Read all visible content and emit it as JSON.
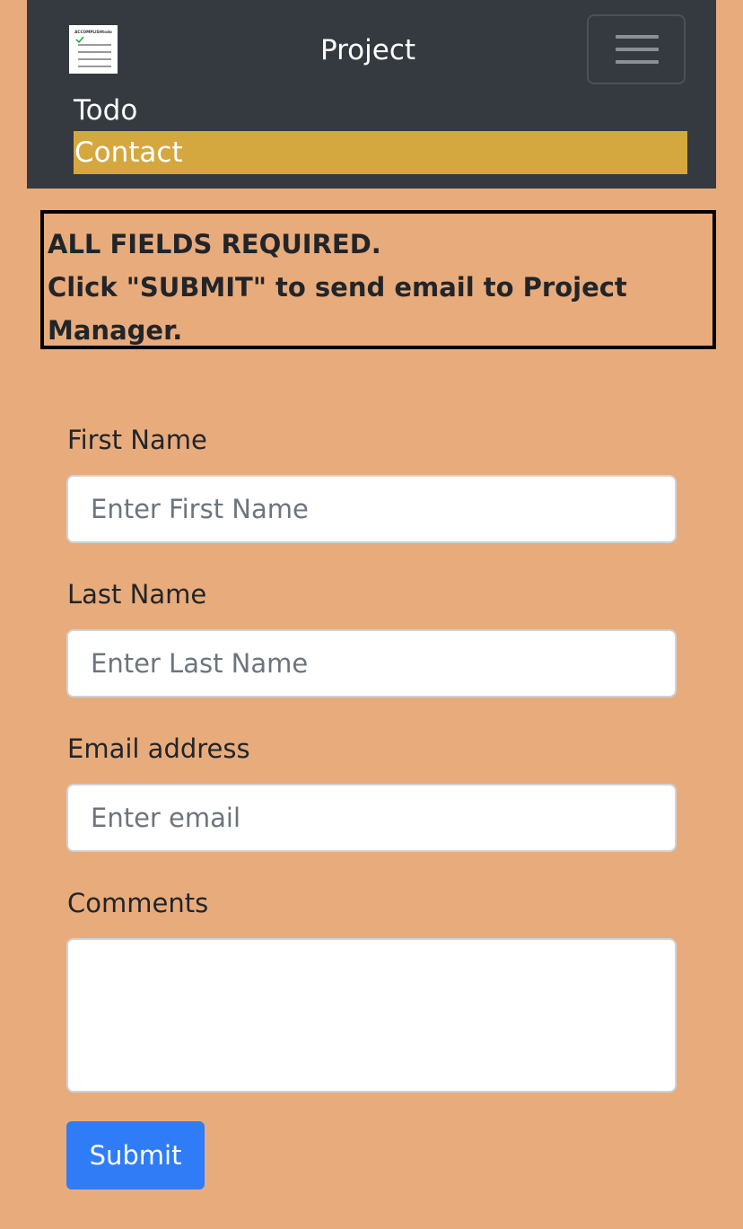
{
  "navbar": {
    "logo_text": "ACCOMPLISHtodo",
    "title": "Project",
    "toggle_icon": "hamburger-icon",
    "links": [
      {
        "label": "Todo",
        "active": false
      },
      {
        "label": "Contact",
        "active": true
      }
    ],
    "colors": {
      "background": "#343a40",
      "active_link": "#d4a83e"
    }
  },
  "notice": {
    "line1": "ALL FIELDS REQUIRED.",
    "line2": "Click \"SUBMIT\" to send email to Project Manager."
  },
  "form": {
    "first_name": {
      "label": "First Name",
      "placeholder": "Enter First Name",
      "value": ""
    },
    "last_name": {
      "label": "Last Name",
      "placeholder": "Enter Last Name",
      "value": ""
    },
    "email": {
      "label": "Email address",
      "placeholder": "Enter email",
      "value": ""
    },
    "comments": {
      "label": "Comments",
      "placeholder": "",
      "value": ""
    },
    "submit_label": "Submit"
  },
  "colors": {
    "page_background": "#e8ab7c",
    "submit_button": "#2f7cf6"
  }
}
